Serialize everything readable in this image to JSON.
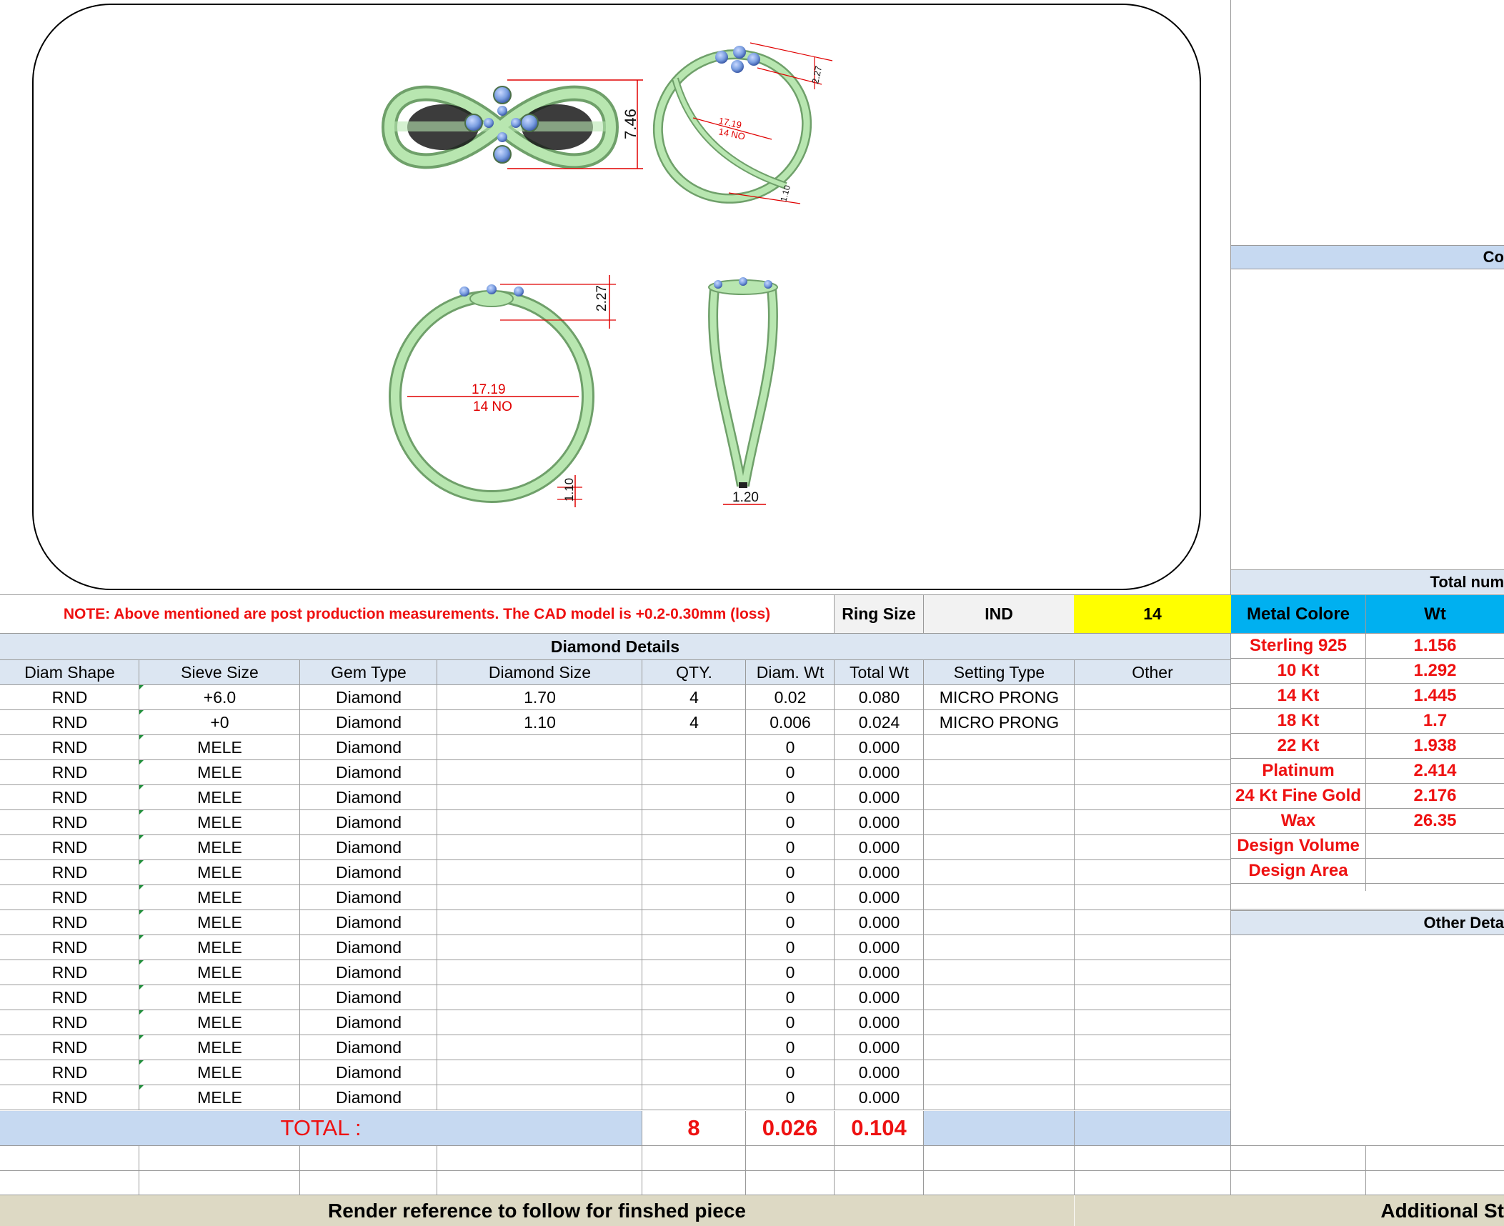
{
  "cad_sheet": {
    "views": {
      "top_height": "7.46",
      "persp_size": "17.19",
      "persp_no": "14 NO",
      "persp_top": "2.27",
      "persp_bottom": "1.10",
      "front_size": "17.19",
      "front_no": "14 NO",
      "front_height": "2.27",
      "front_thickness": "1.10",
      "side_width": "1.20"
    }
  },
  "note": "NOTE: Above mentioned are post production measurements. The CAD model is +0.2-0.30mm (loss)",
  "ring_size": {
    "label": "Ring Size",
    "standard": "IND",
    "value": "14"
  },
  "diamond_details": {
    "title": "Diamond Details",
    "headers": [
      "Diam Shape",
      "Sieve Size",
      "Gem Type",
      "Diamond Size",
      "QTY.",
      "Diam. Wt",
      "Total Wt",
      "Setting Type",
      "Other"
    ],
    "rows": [
      [
        "RND",
        "+6.0",
        "Diamond",
        "1.70",
        "4",
        "0.02",
        "0.080",
        "MICRO PRONG",
        ""
      ],
      [
        "RND",
        "+0",
        "Diamond",
        "1.10",
        "4",
        "0.006",
        "0.024",
        "MICRO PRONG",
        ""
      ],
      [
        "RND",
        "MELE",
        "Diamond",
        "",
        "",
        "0",
        "0.000",
        "",
        ""
      ],
      [
        "RND",
        "MELE",
        "Diamond",
        "",
        "",
        "0",
        "0.000",
        "",
        ""
      ],
      [
        "RND",
        "MELE",
        "Diamond",
        "",
        "",
        "0",
        "0.000",
        "",
        ""
      ],
      [
        "RND",
        "MELE",
        "Diamond",
        "",
        "",
        "0",
        "0.000",
        "",
        ""
      ],
      [
        "RND",
        "MELE",
        "Diamond",
        "",
        "",
        "0",
        "0.000",
        "",
        ""
      ],
      [
        "RND",
        "MELE",
        "Diamond",
        "",
        "",
        "0",
        "0.000",
        "",
        ""
      ],
      [
        "RND",
        "MELE",
        "Diamond",
        "",
        "",
        "0",
        "0.000",
        "",
        ""
      ],
      [
        "RND",
        "MELE",
        "Diamond",
        "",
        "",
        "0",
        "0.000",
        "",
        ""
      ],
      [
        "RND",
        "MELE",
        "Diamond",
        "",
        "",
        "0",
        "0.000",
        "",
        ""
      ],
      [
        "RND",
        "MELE",
        "Diamond",
        "",
        "",
        "0",
        "0.000",
        "",
        ""
      ],
      [
        "RND",
        "MELE",
        "Diamond",
        "",
        "",
        "0",
        "0.000",
        "",
        ""
      ],
      [
        "RND",
        "MELE",
        "Diamond",
        "",
        "",
        "0",
        "0.000",
        "",
        ""
      ],
      [
        "RND",
        "MELE",
        "Diamond",
        "",
        "",
        "0",
        "0.000",
        "",
        ""
      ],
      [
        "RND",
        "MELE",
        "Diamond",
        "",
        "",
        "0",
        "0.000",
        "",
        ""
      ],
      [
        "RND",
        "MELE",
        "Diamond",
        "",
        "",
        "0",
        "0.000",
        "",
        ""
      ]
    ],
    "total": {
      "label": "TOTAL :",
      "qty": "8",
      "diam_wt": "0.026",
      "total_wt": "0.104"
    }
  },
  "metal": {
    "header_color": "Metal Colore",
    "header_wt": "Wt",
    "rows": [
      [
        "Sterling 925",
        "1.156"
      ],
      [
        "10 Kt",
        "1.292"
      ],
      [
        "14 Kt",
        "1.445"
      ],
      [
        "18 Kt",
        "1.7"
      ],
      [
        "22 Kt",
        "1.938"
      ],
      [
        "Platinum",
        "2.414"
      ],
      [
        "24 Kt Fine Gold",
        "2.176"
      ],
      [
        "Wax",
        "26.35"
      ],
      [
        "Design Volume",
        ""
      ],
      [
        "Design Area",
        ""
      ]
    ]
  },
  "right_panel": {
    "co_header": "Co",
    "total_header": "Total num",
    "other_header": "Other Deta"
  },
  "footer": {
    "render_reference": "Render reference to follow for finshed piece",
    "additional": "Additional St"
  },
  "colors": {
    "header_blue": "#c6d9f1",
    "metal_header_blue": "#00b0f0",
    "ring_size_yellow": "#ffff00",
    "note_red": "#ee1111",
    "footer_tan": "#ddd9c4",
    "ring_green": "#b8e6b0",
    "stone_blue": "#7a9ee0",
    "dimension_red": "#e00000"
  }
}
